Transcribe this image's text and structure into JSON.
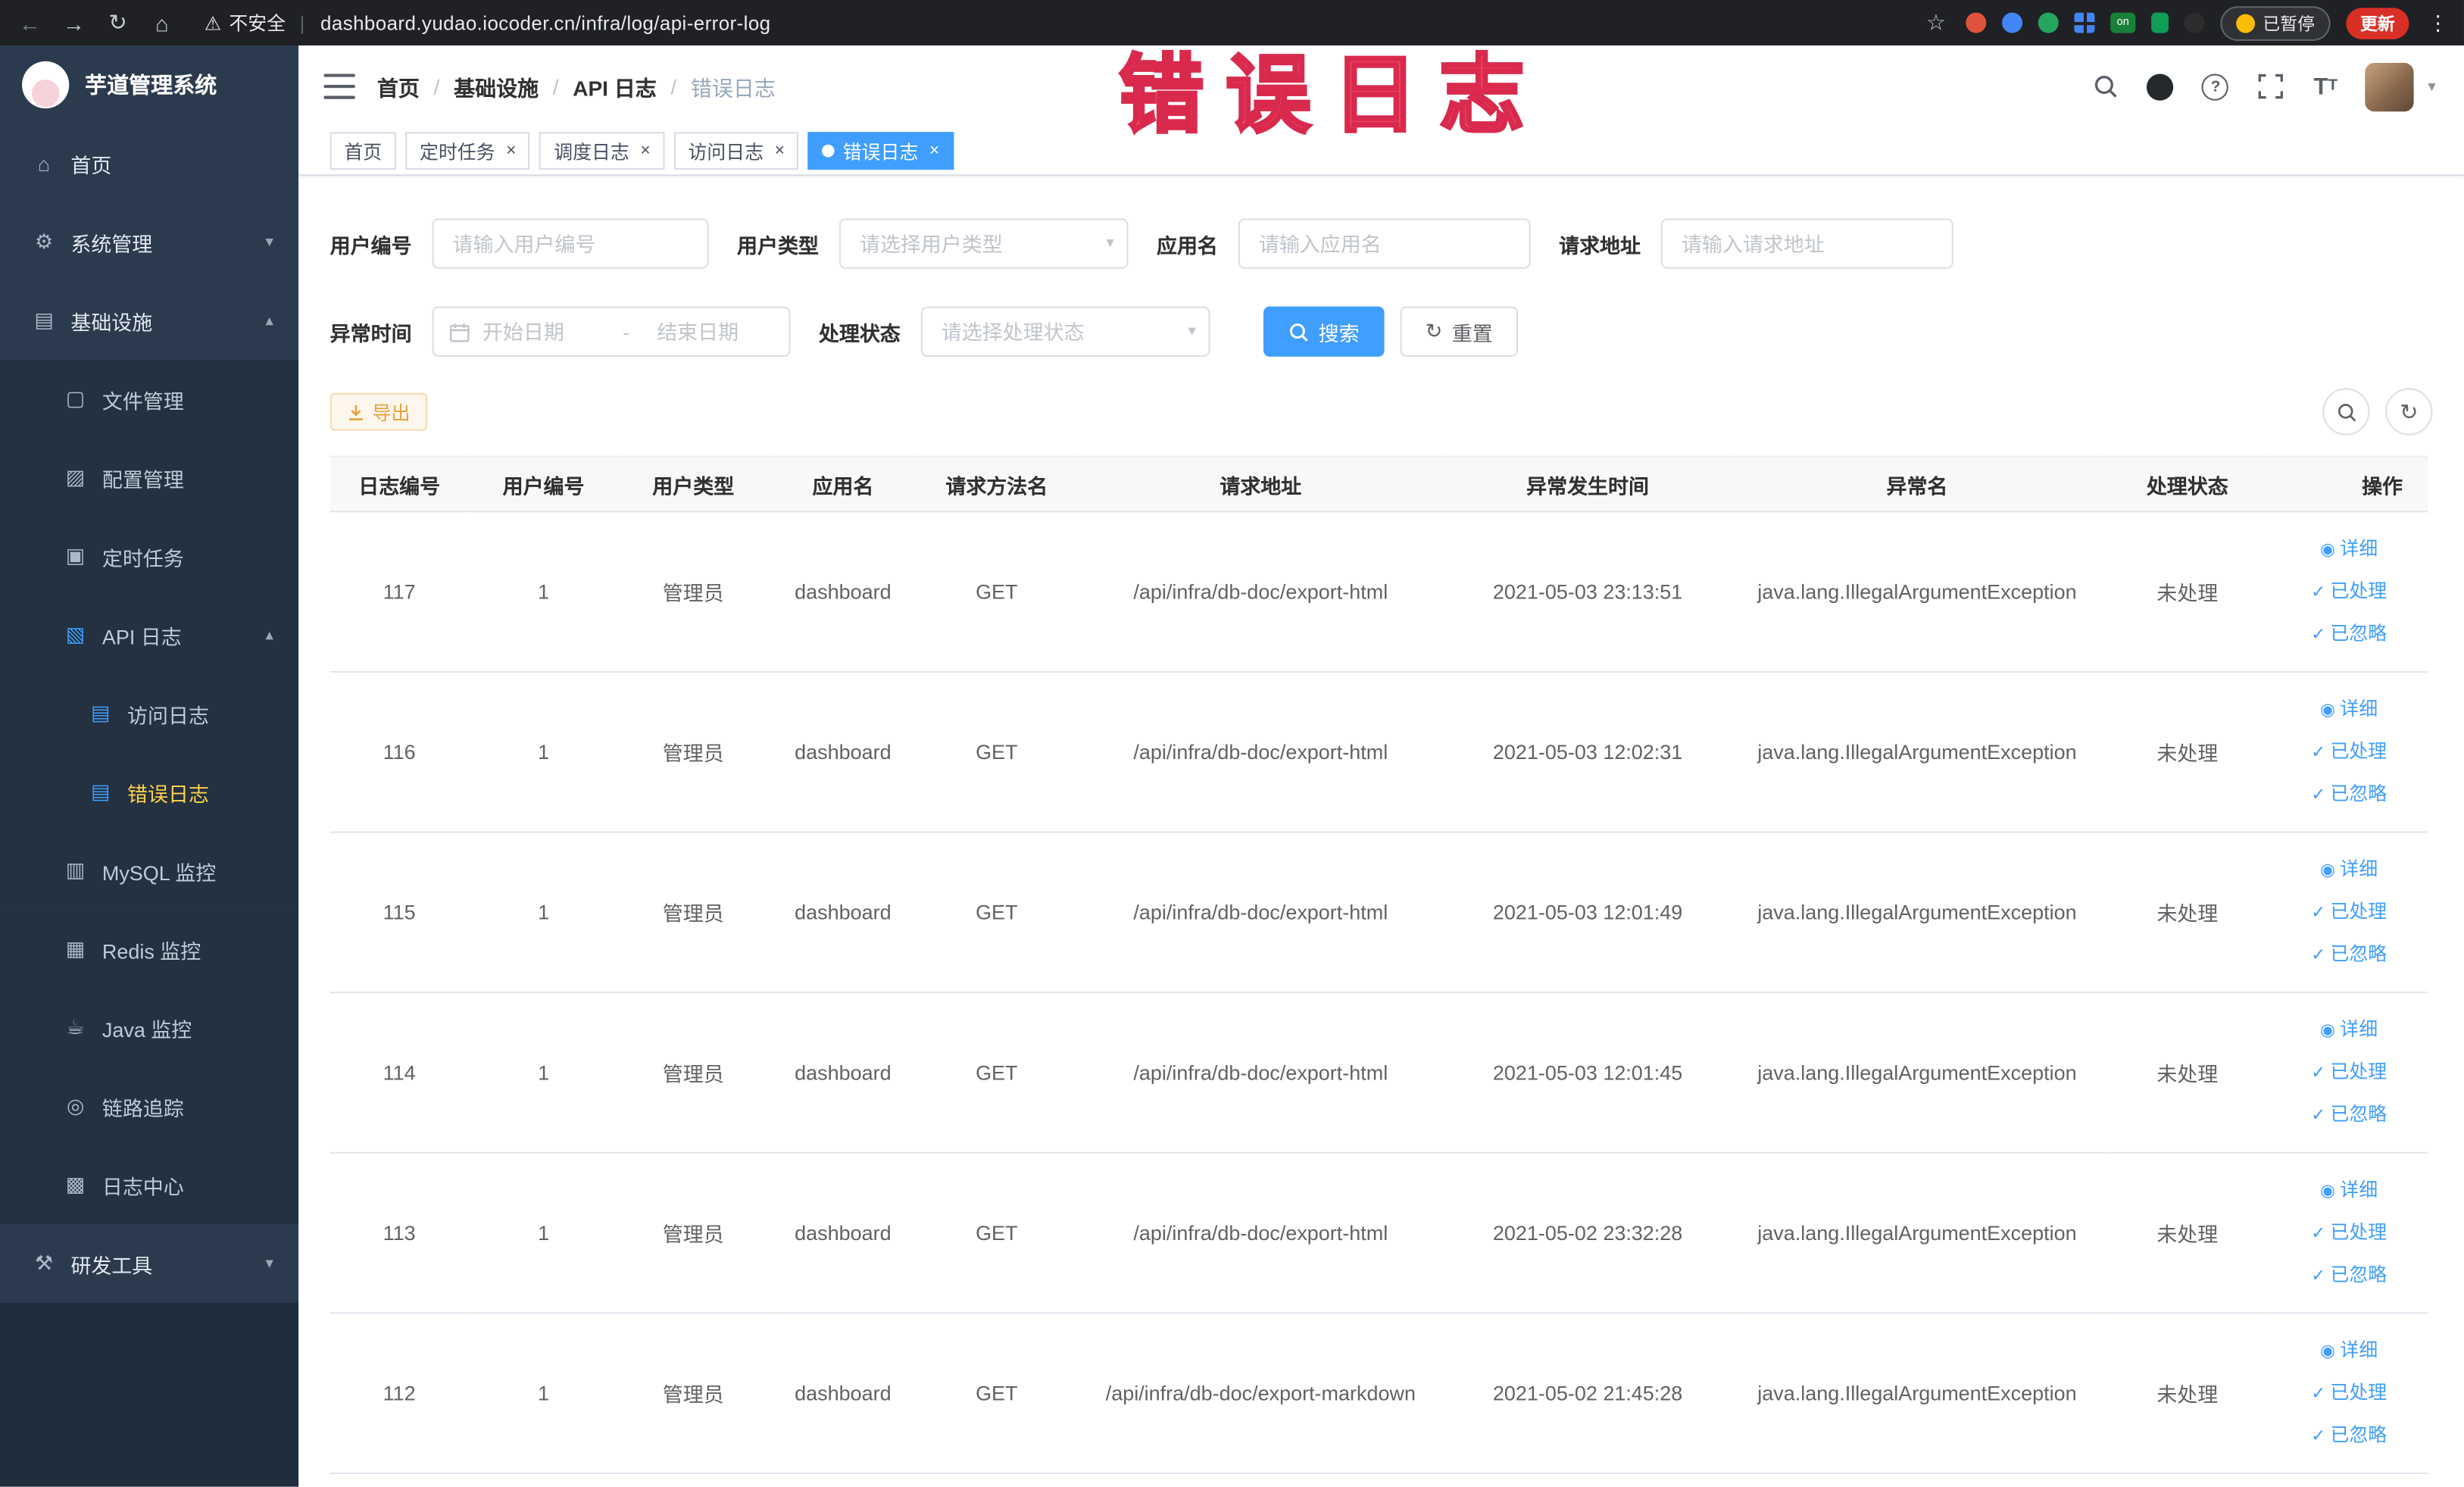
{
  "browser": {
    "security": "不安全",
    "url": "dashboard.yudao.iocoder.cn/infra/log/api-error-log",
    "on_badge": "on",
    "paused": "已暂停",
    "update": "更新"
  },
  "watermark": "错误日志",
  "sidebar": {
    "logo_title": "芋道管理系统",
    "items": [
      {
        "label": "首页"
      },
      {
        "label": "系统管理"
      },
      {
        "label": "基础设施"
      },
      {
        "label": "文件管理"
      },
      {
        "label": "配置管理"
      },
      {
        "label": "定时任务"
      },
      {
        "label": "API 日志"
      },
      {
        "label": "访问日志"
      },
      {
        "label": "错误日志"
      },
      {
        "label": "MySQL 监控"
      },
      {
        "label": "Redis 监控"
      },
      {
        "label": "Java 监控"
      },
      {
        "label": "链路追踪"
      },
      {
        "label": "日志中心"
      },
      {
        "label": "研发工具"
      }
    ]
  },
  "navbar": {
    "breadcrumb": [
      "首页",
      "基础设施",
      "API 日志",
      "错误日志"
    ],
    "separator": "/"
  },
  "tabs": [
    {
      "label": "首页"
    },
    {
      "label": "定时任务"
    },
    {
      "label": "调度日志"
    },
    {
      "label": "访问日志"
    },
    {
      "label": "错误日志"
    }
  ],
  "filters": {
    "user_id_label": "用户编号",
    "user_id_placeholder": "请输入用户编号",
    "user_type_label": "用户类型",
    "user_type_placeholder": "请选择用户类型",
    "app_name_label": "应用名",
    "app_name_placeholder": "请输入应用名",
    "req_url_label": "请求地址",
    "req_url_placeholder": "请输入请求地址",
    "time_label": "异常时间",
    "time_start_placeholder": "开始日期",
    "time_range_separator": "-",
    "time_end_placeholder": "结束日期",
    "status_label": "处理状态",
    "status_placeholder": "请选择处理状态",
    "search_button": "搜索",
    "reset_button": "重置"
  },
  "toolbar": {
    "export_button": "导出"
  },
  "table": {
    "headers": [
      "日志编号",
      "用户编号",
      "用户类型",
      "应用名",
      "请求方法名",
      "请求地址",
      "异常发生时间",
      "异常名",
      "处理状态",
      "操作"
    ],
    "rows": [
      [
        117,
        1,
        "管理员",
        "dashboard",
        "GET",
        "/api/infra/db-doc/export-html",
        "2021-05-03 23:13:51",
        "java.lang.IllegalArgumentException",
        "未处理"
      ],
      [
        116,
        1,
        "管理员",
        "dashboard",
        "GET",
        "/api/infra/db-doc/export-html",
        "2021-05-03 12:02:31",
        "java.lang.IllegalArgumentException",
        "未处理"
      ],
      [
        115,
        1,
        "管理员",
        "dashboard",
        "GET",
        "/api/infra/db-doc/export-html",
        "2021-05-03 12:01:49",
        "java.lang.IllegalArgumentException",
        "未处理"
      ],
      [
        114,
        1,
        "管理员",
        "dashboard",
        "GET",
        "/api/infra/db-doc/export-html",
        "2021-05-03 12:01:45",
        "java.lang.IllegalArgumentException",
        "未处理"
      ],
      [
        113,
        1,
        "管理员",
        "dashboard",
        "GET",
        "/api/infra/db-doc/export-html",
        "2021-05-02 23:32:28",
        "java.lang.IllegalArgumentException",
        "未处理"
      ],
      [
        112,
        1,
        "管理员",
        "dashboard",
        "GET",
        "/api/infra/db-doc/export-markdown",
        "2021-05-02 21:45:28",
        "java.lang.IllegalArgumentException",
        "未处理"
      ]
    ],
    "actions": [
      "详细",
      "已处理",
      "已忽略"
    ]
  }
}
